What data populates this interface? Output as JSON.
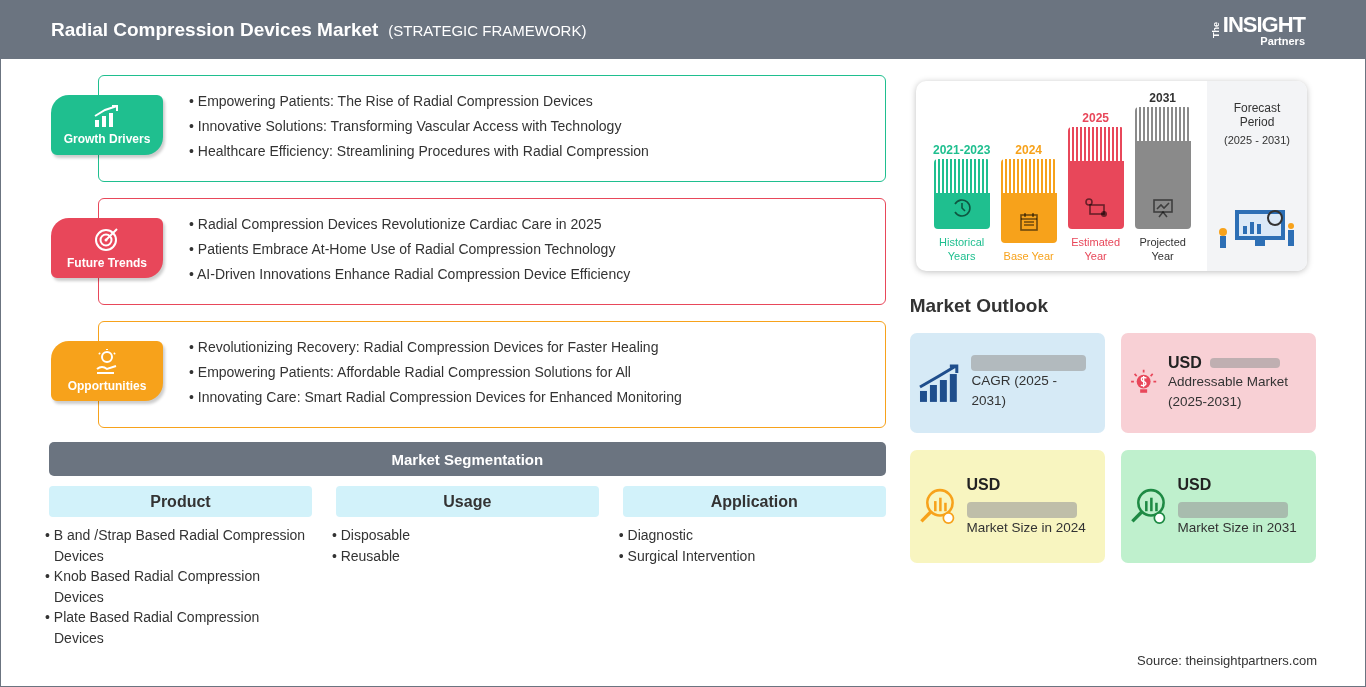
{
  "header": {
    "title": "Radial Compression Devices Market",
    "subtitle": "(STRATEGIC FRAMEWORK)",
    "logo": {
      "small": "The",
      "main": "INSIGHT",
      "sub": "Partners"
    }
  },
  "framework": [
    {
      "kind": "growth",
      "label": "Growth Drivers",
      "color": "#1fbf8f",
      "items": [
        "• Empowering Patients: The Rise of Radial Compression Devices",
        "• Innovative Solutions: Transforming Vascular Access with Technology",
        "• Healthcare Efficiency: Streamlining Procedures with Radial Compression"
      ]
    },
    {
      "kind": "trends",
      "label": "Future Trends",
      "color": "#e8475a",
      "items": [
        "• Radial Compression Devices Revolutionize Cardiac Care in 2025",
        "• Patients Embrace At-Home Use of Radial Compression Technology",
        "• AI-Driven Innovations Enhance Radial Compression Device Efficiency"
      ]
    },
    {
      "kind": "opportunities",
      "label": "Opportunities",
      "color": "#f7a21b",
      "items": [
        "• Revolutionizing Recovery: Radial Compression Devices for Faster Healing",
        "• Empowering Patients: Affordable Radial Compression Solutions for All",
        "• Innovating Care: Smart Radial Compression Devices for Enhanced Monitoring"
      ]
    }
  ],
  "segmentation": {
    "title": "Market Segmentation",
    "columns": [
      {
        "heading": "Product",
        "items": [
          "• B and /Strap Based Radial Compression Devices",
          "• Knob Based Radial Compression Devices",
          "• Plate Based Radial Compression Devices"
        ]
      },
      {
        "heading": "Usage",
        "items": [
          "• Disposable",
          "• Reusable"
        ]
      },
      {
        "heading": "Application",
        "items": [
          "• Diagnostic",
          "• Surgical Intervention"
        ]
      }
    ]
  },
  "timeline": {
    "periods": [
      {
        "kind": "history",
        "year": "2021-2023",
        "label": "Historical Years",
        "color": "#1fbf8f"
      },
      {
        "kind": "base",
        "year": "2024",
        "label": "Base Year",
        "color": "#f7a21b"
      },
      {
        "kind": "estimated",
        "year": "2025",
        "label": "Estimated Year",
        "color": "#e8475a"
      },
      {
        "kind": "projected",
        "year": "2031",
        "label": "Projected Year",
        "color": "#8a8a8a"
      }
    ],
    "forecast": {
      "title": "Forecast Period",
      "range": "(2025 - 2031)"
    }
  },
  "outlook": {
    "title": "Market Outlook",
    "cards": [
      {
        "kind": "cagr",
        "label": "CAGR (2025 - 2031)",
        "color": "#d6eaf6"
      },
      {
        "kind": "addressable",
        "prefix": "USD",
        "label": "Addressable Market (2025-2031)",
        "color": "#f8d0d5"
      },
      {
        "kind": "size2024",
        "prefix": "USD",
        "label": "Market Size in 2024",
        "color": "#f8f5c0"
      },
      {
        "kind": "size2031",
        "prefix": "USD",
        "label": "Market Size in 2031",
        "color": "#bff0cd"
      }
    ]
  },
  "source": "Source: theinsightpartners.com"
}
